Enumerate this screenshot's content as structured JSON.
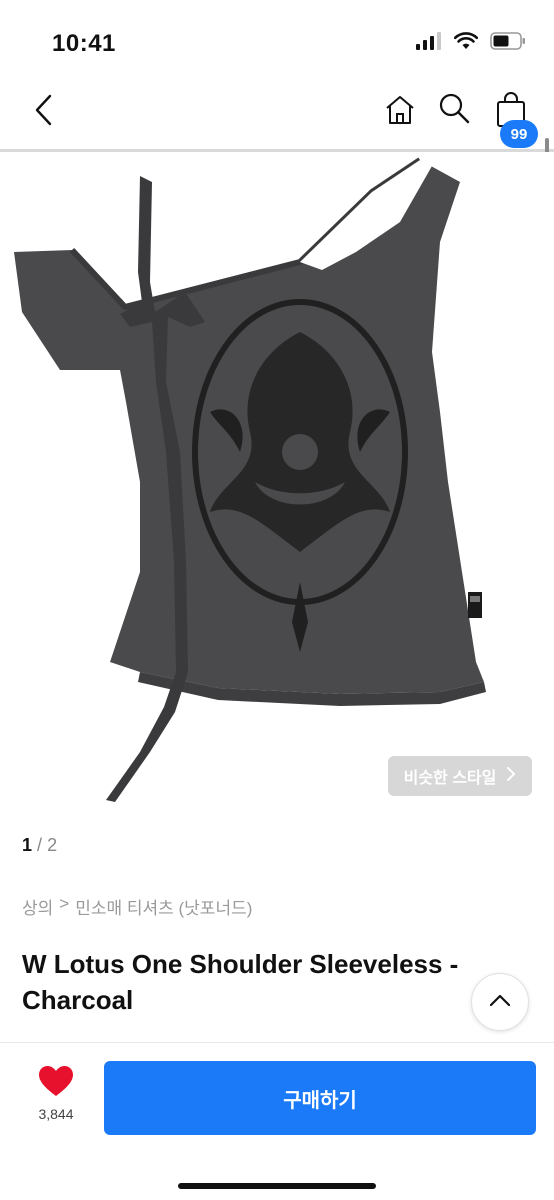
{
  "status": {
    "time": "10:41",
    "battery_level": 0.6
  },
  "nav": {
    "icons": [
      "back-icon",
      "home-icon",
      "search-icon",
      "shopping-bag-icon"
    ],
    "cart_count": "99"
  },
  "gallery": {
    "current": "1",
    "separator": "/",
    "total": "2",
    "similar_style_label": "비슷한 스타일"
  },
  "product": {
    "breadcrumb": [
      "상의",
      ">",
      "민소매 티셔츠 (낫포너드)"
    ],
    "title": "W Lotus One Shoulder Sleeveless - Charcoal",
    "image_color": "#4a4a4c"
  },
  "actions": {
    "like_count": "3,844",
    "buy_label": "구매하기"
  },
  "colors": {
    "accent": "#1a7af8",
    "heart": "#e8112d"
  }
}
